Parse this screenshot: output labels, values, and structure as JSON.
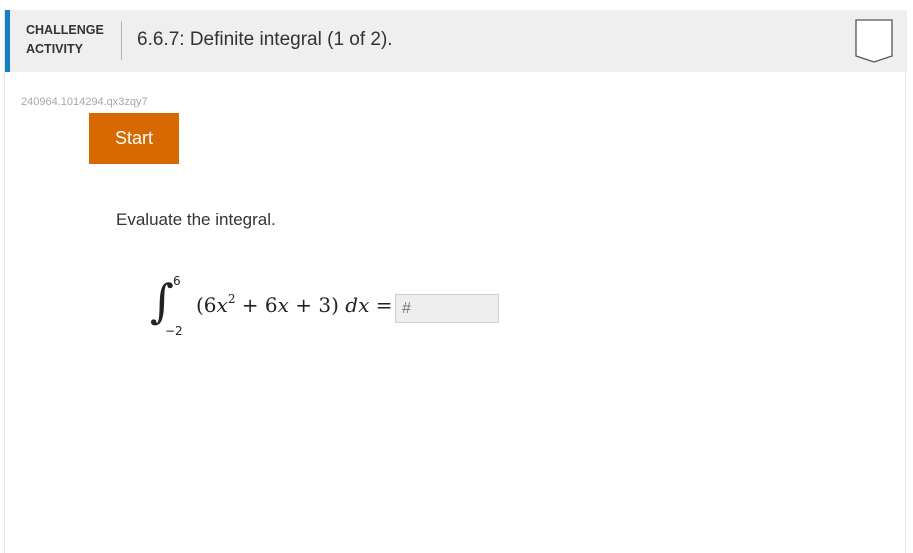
{
  "header": {
    "label_line1": "CHALLENGE",
    "label_line2": "ACTIVITY",
    "title": "6.6.7: Definite integral (1 of 2).",
    "accent_color": "#1380c4"
  },
  "activity": {
    "id": "240964.1014294.qx3zqy7",
    "start_label": "Start",
    "start_color": "#d66a00"
  },
  "question": {
    "prompt": "Evaluate the integral.",
    "integral_sign": "∫",
    "upper_limit": "6",
    "lower_limit": "−2",
    "integrand": {
      "open": "(6",
      "var1": "x",
      "exp": "2",
      "plus1": " + 6",
      "var2": "x",
      "rest": " + 3) ",
      "dx": "dx",
      "equals": " ="
    },
    "answer_placeholder": "#"
  },
  "icons": {
    "badge": "completion-badge-icon"
  }
}
